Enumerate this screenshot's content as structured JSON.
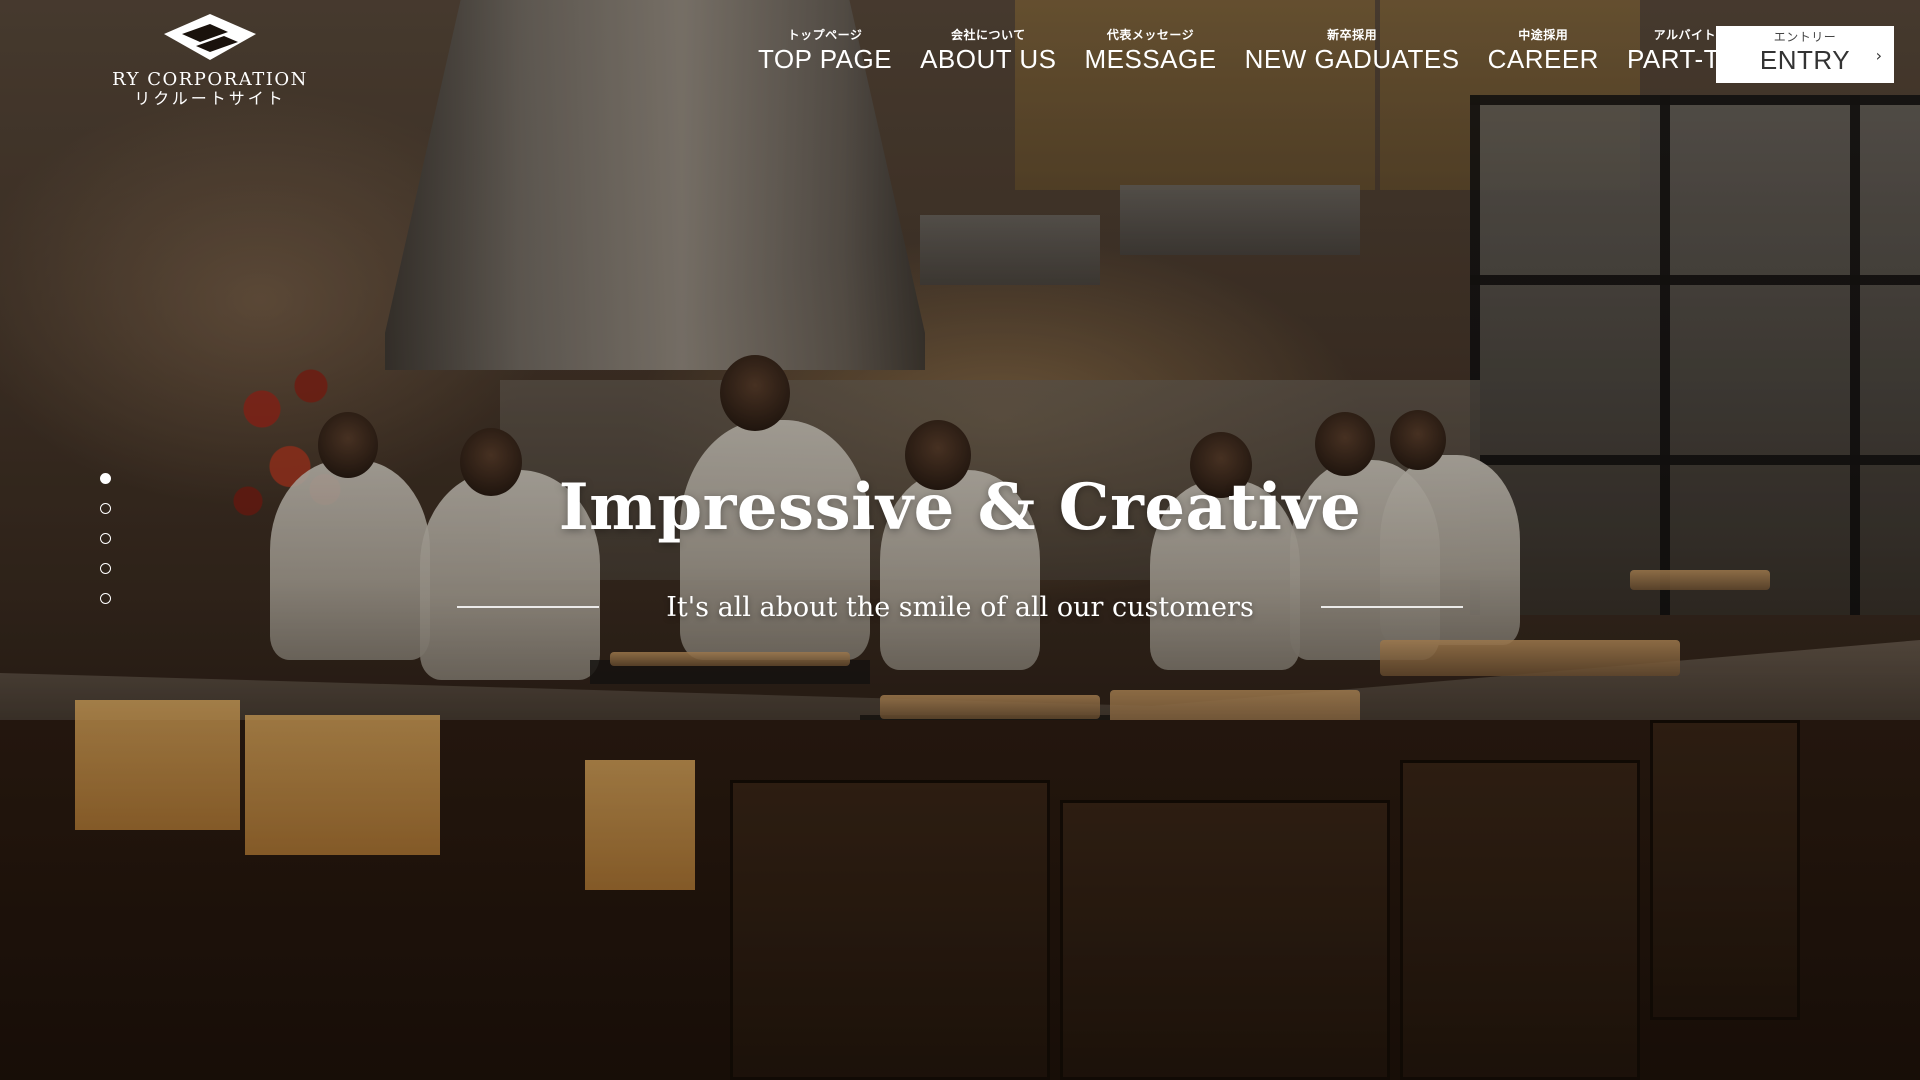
{
  "brand": {
    "name": "RY CORPORATION",
    "subtitle": "リクルートサイト"
  },
  "nav": {
    "items": [
      {
        "jp": "トップページ",
        "en": "TOP PAGE"
      },
      {
        "jp": "会社について",
        "en": "ABOUT US"
      },
      {
        "jp": "代表メッセージ",
        "en": "MESSAGE"
      },
      {
        "jp": "新卒採用",
        "en": "NEW GADUATES"
      },
      {
        "jp": "中途採用",
        "en": "CAREER"
      },
      {
        "jp": "アルバイト採用",
        "en": "PART-TIME"
      }
    ],
    "entry": {
      "jp": "エントリー",
      "en": "ENTRY",
      "arrow_icon": "chevron-right-icon"
    }
  },
  "hero": {
    "title": "Impressive & Creative",
    "subtitle": "It's all about the smile of all our customers"
  },
  "slider": {
    "total": 5,
    "active_index": 0
  },
  "colors": {
    "text": "#ffffff",
    "entry_bg": "#ffffff",
    "entry_text": "#333333"
  }
}
